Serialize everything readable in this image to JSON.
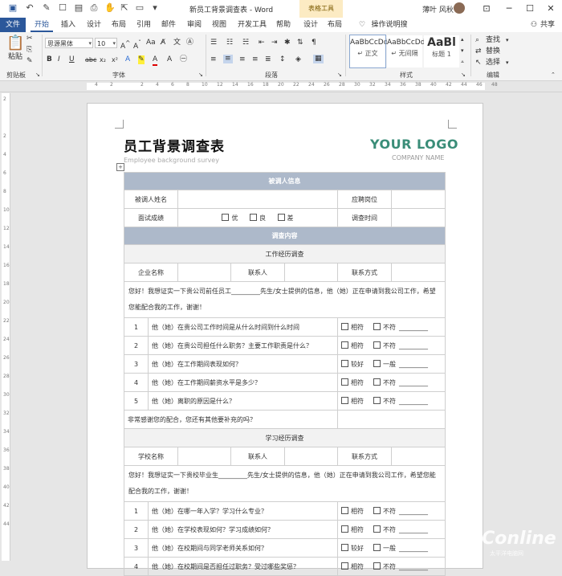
{
  "titlebar": {
    "doc_title": "新员工背景调查表  -  Word",
    "context_tools": "表格工具",
    "user_name": "薄叶 风秋"
  },
  "tabs": [
    "文件",
    "开始",
    "插入",
    "设计",
    "布局",
    "引用",
    "邮件",
    "审阅",
    "视图",
    "开发工具",
    "帮助",
    "设计",
    "布局"
  ],
  "tell_me": "操作说明搜索",
  "share": "共享",
  "ribbon": {
    "paste": "粘贴",
    "clipboard": "剪贴板",
    "font_name": "思源黑体",
    "font_size": "10",
    "font": "字体",
    "paragraph": "段落",
    "styles": "样式",
    "editing": "编辑",
    "style_items": [
      {
        "sample": "AaBbCcDd",
        "name": "↵ 正文"
      },
      {
        "sample": "AaBbCcDd",
        "name": "↵ 无间隔"
      },
      {
        "sample": "AaBl",
        "name": "标题 1"
      }
    ],
    "find": "查找",
    "replace": "替换",
    "select": "选择"
  },
  "ruler": [
    "4",
    "2",
    "",
    "2",
    "4",
    "6",
    "8",
    "10",
    "12",
    "14",
    "16",
    "18",
    "20",
    "22",
    "24",
    "26",
    "28",
    "30",
    "32",
    "34",
    "36",
    "38",
    "40",
    "42",
    "44",
    "46",
    "48"
  ],
  "vruler": [
    "2",
    "",
    "2",
    "4",
    "6",
    "8",
    "10",
    "12",
    "14",
    "16",
    "18",
    "20",
    "22",
    "24",
    "26",
    "28",
    "30",
    "32",
    "34",
    "36",
    "38",
    "40",
    "42",
    "44"
  ],
  "doc": {
    "title": "员工背景调查表",
    "subtitle": "Employee background survey",
    "logo": "YOUR LOGO",
    "company": "COMPANY NAME",
    "sec1": "被调人信息",
    "name_label": "被调人姓名",
    "position_label": "应聘岗位",
    "interview_label": "面试成绩",
    "grade_opts": [
      "优",
      "良",
      "差"
    ],
    "survey_time": "调查时间",
    "sec2": "调查内容",
    "work_title": "工作经历调查",
    "company_col": "企业名称",
    "contact_col": "联系人",
    "method_col": "联系方式",
    "work_intro": "您好！我想证实一下贵公司前任员工_________先生/女士提供的信息，他（她）正在申请到我公司工作，希望您能配合我的工作，谢谢！",
    "work_qs": [
      {
        "n": "1",
        "q": "他（她）在贵公司工作时间是从什么时间到什么时间",
        "a": "相符",
        "b": "不符",
        "c": "_________"
      },
      {
        "n": "2",
        "q": "他（她）在贵公司担任什么职务？主要工作职责是什么？",
        "a": "相符",
        "b": "不符",
        "c": "_________"
      },
      {
        "n": "3",
        "q": "他（她）在工作期间表现如何？",
        "a": "较好",
        "b": "一般",
        "c": "_________"
      },
      {
        "n": "4",
        "q": "他（她）在工作期间薪资水平是多少？",
        "a": "相符",
        "b": "不符",
        "c": "_________"
      },
      {
        "n": "5",
        "q": "他（她）离职的原因是什么？",
        "a": "相符",
        "b": "不符",
        "c": "_________"
      }
    ],
    "thanks": "非常感谢您的配合，您还有其他要补充的吗？",
    "study_title": "学习经历调查",
    "school_col": "学校名称",
    "study_intro": "您好！我想证实一下贵校毕业生_________先生/女士提供的信息，他（她）正在申请到我公司工作，希望您能配合我的工作，谢谢！",
    "study_qs": [
      {
        "n": "1",
        "q": "他（她）在哪一年入学？学习什么专业？",
        "a": "相符",
        "b": "不符",
        "c": "_________"
      },
      {
        "n": "2",
        "q": "他（她）在学校表现如何？学习成绩如何？",
        "a": "相符",
        "b": "不符",
        "c": "_________"
      },
      {
        "n": "3",
        "q": "他（她）在校期间与同学老师关系如何？",
        "a": "较好",
        "b": "一般",
        "c": "_________"
      },
      {
        "n": "4",
        "q": "他（她）在校期间是否担任过职务？受过哪些奖惩？",
        "a": "相符",
        "b": "不符",
        "c": "_________"
      }
    ]
  },
  "watermark": "PConline",
  "watermark_sub": "太平洋电脑网"
}
